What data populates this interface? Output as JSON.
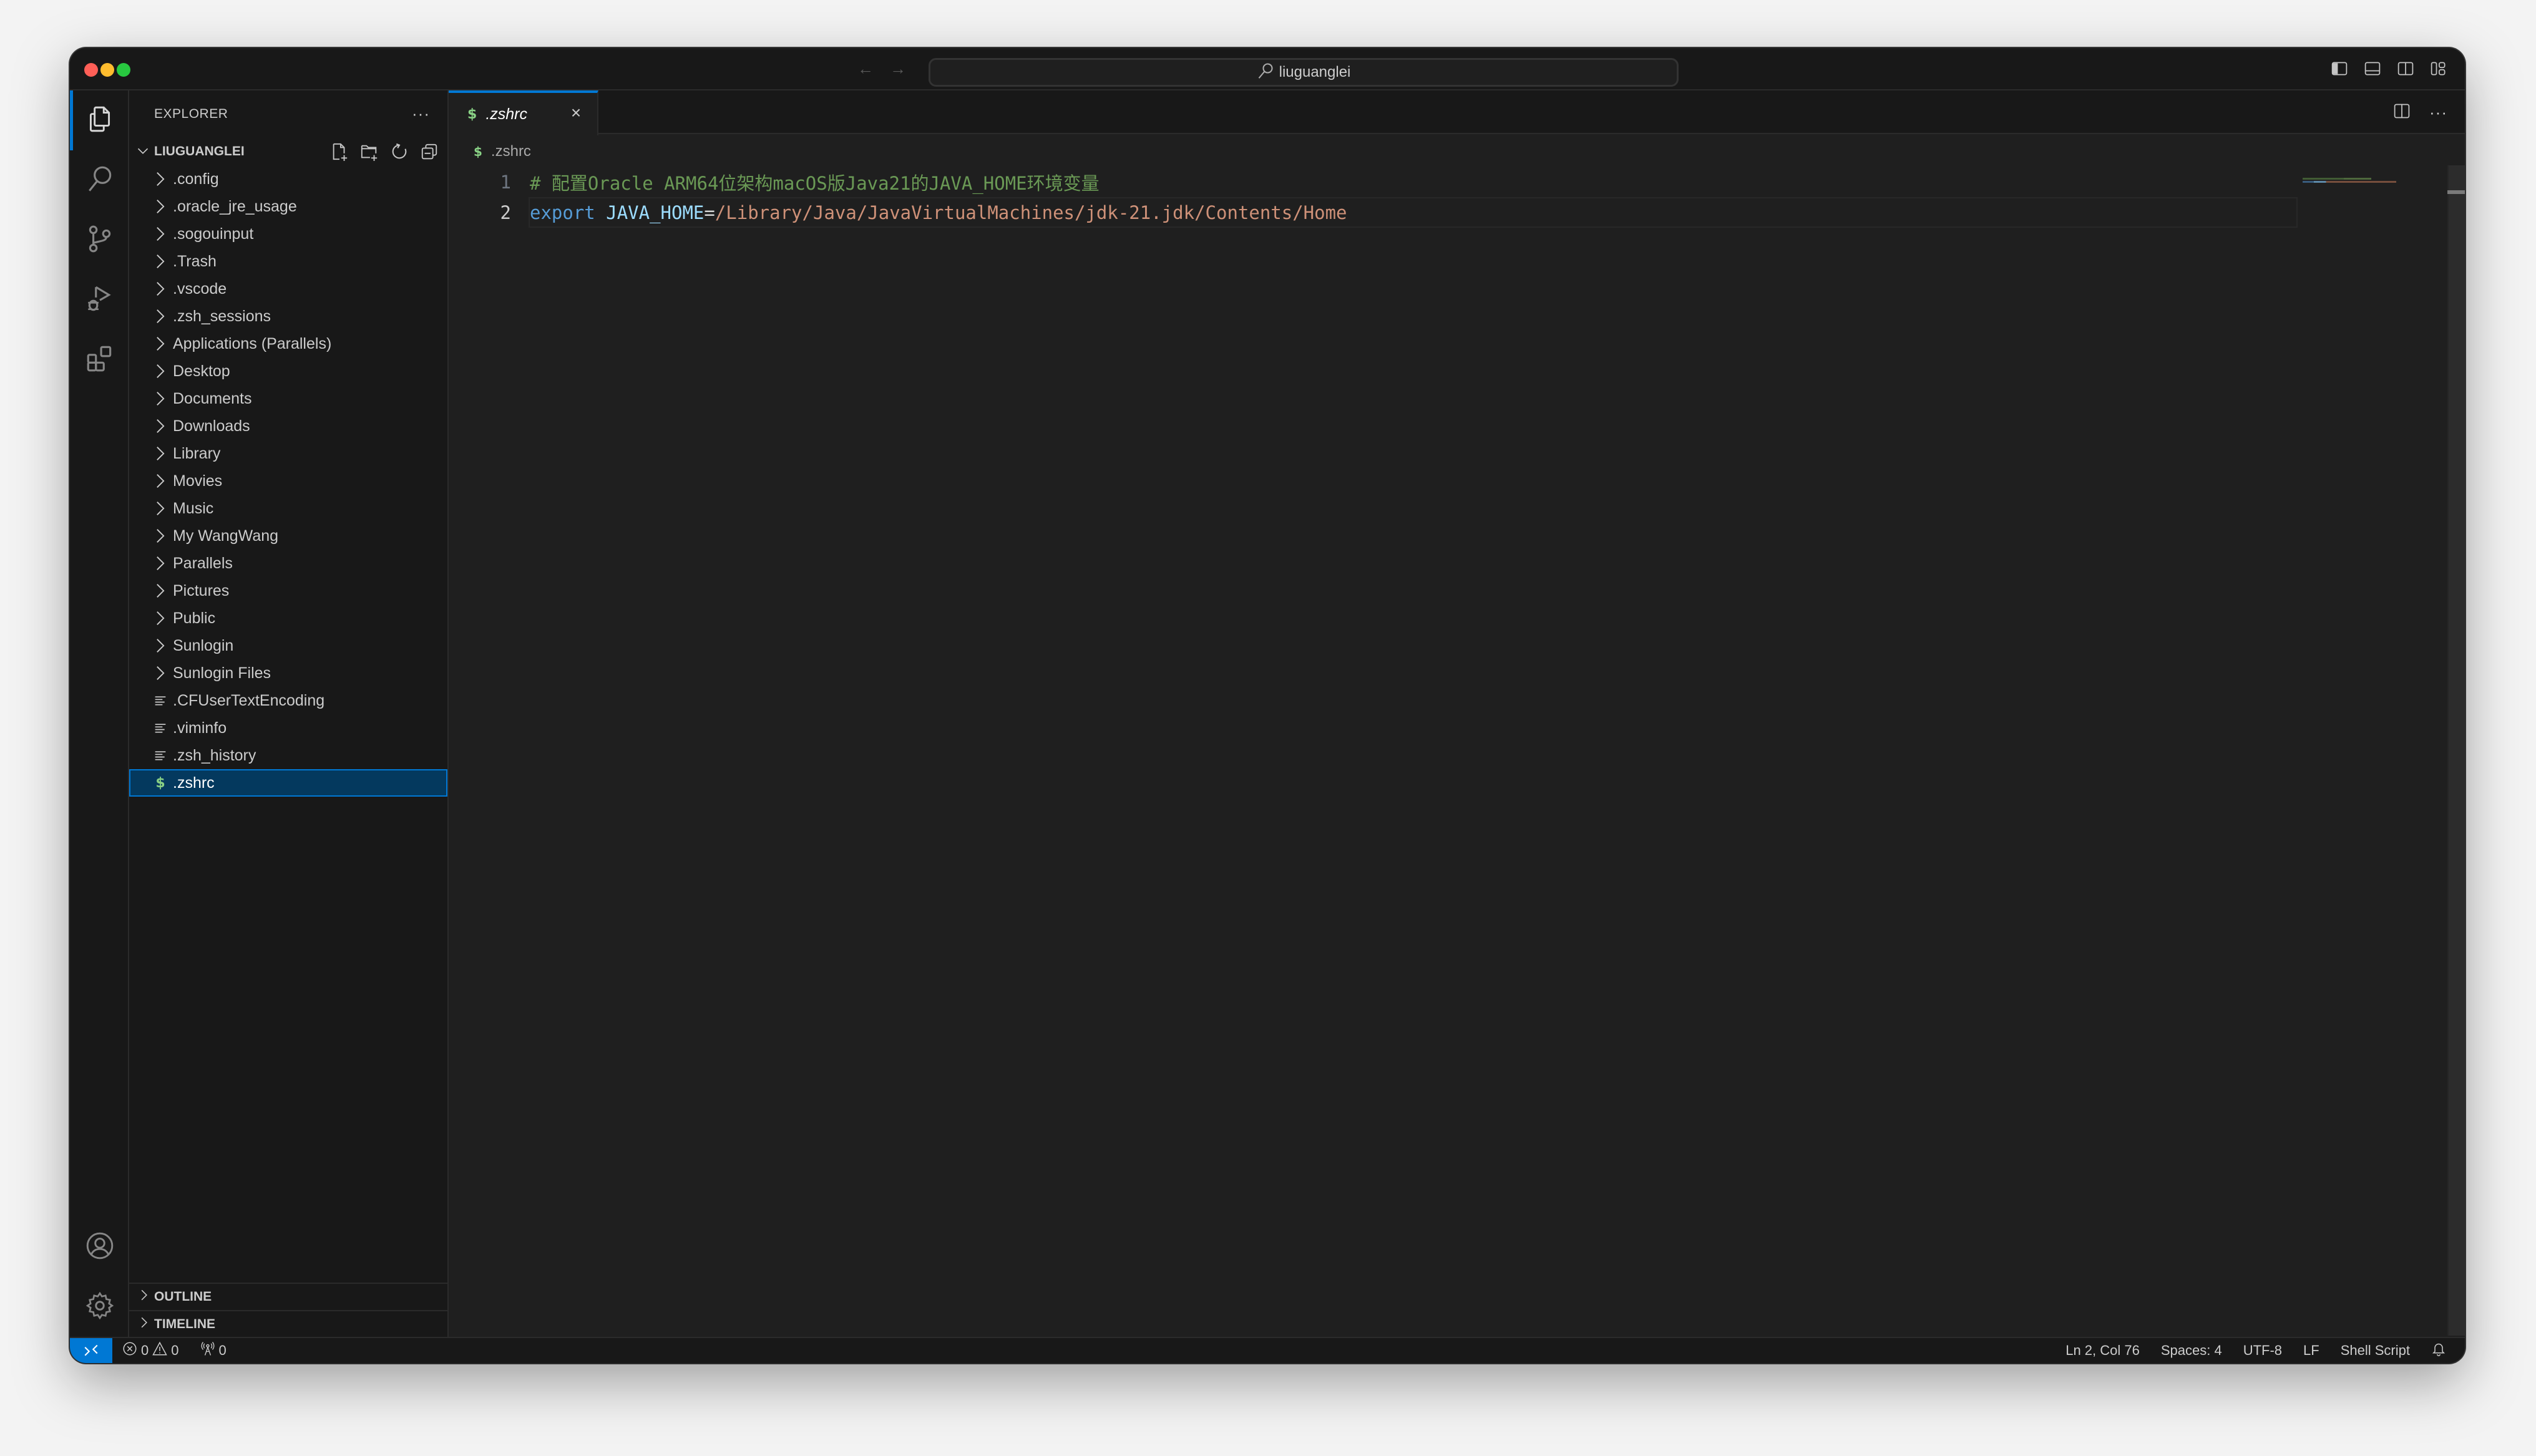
{
  "titlebar": {
    "search_text": "liuguanglei",
    "back_icon": "arrow-left-icon",
    "forward_icon": "arrow-right-icon",
    "layout_icons": [
      "toggle-primary-sidebar-icon",
      "toggle-panel-icon",
      "toggle-secondary-sidebar-icon",
      "customize-layout-icon"
    ]
  },
  "activitybar": {
    "items": [
      {
        "name": "explorer",
        "icon": "files-icon",
        "active": true
      },
      {
        "name": "search",
        "icon": "search-icon",
        "active": false
      },
      {
        "name": "source-control",
        "icon": "source-control-icon",
        "active": false
      },
      {
        "name": "run-debug",
        "icon": "run-debug-icon",
        "active": false
      },
      {
        "name": "extensions",
        "icon": "extensions-icon",
        "active": false
      }
    ],
    "bottom": [
      {
        "name": "accounts",
        "icon": "account-icon"
      },
      {
        "name": "manage",
        "icon": "gear-icon"
      }
    ]
  },
  "sidebar": {
    "title": "EXPLORER",
    "more": "···",
    "root": "LIUGUANGLEI",
    "items": [
      {
        "label": ".config",
        "type": "folder"
      },
      {
        "label": ".oracle_jre_usage",
        "type": "folder"
      },
      {
        "label": ".sogouinput",
        "type": "folder"
      },
      {
        "label": ".Trash",
        "type": "folder"
      },
      {
        "label": ".vscode",
        "type": "folder"
      },
      {
        "label": ".zsh_sessions",
        "type": "folder"
      },
      {
        "label": "Applications (Parallels)",
        "type": "folder"
      },
      {
        "label": "Desktop",
        "type": "folder"
      },
      {
        "label": "Documents",
        "type": "folder"
      },
      {
        "label": "Downloads",
        "type": "folder"
      },
      {
        "label": "Library",
        "type": "folder"
      },
      {
        "label": "Movies",
        "type": "folder"
      },
      {
        "label": "Music",
        "type": "folder"
      },
      {
        "label": "My WangWang",
        "type": "folder"
      },
      {
        "label": "Parallels",
        "type": "folder"
      },
      {
        "label": "Pictures",
        "type": "folder"
      },
      {
        "label": "Public",
        "type": "folder"
      },
      {
        "label": "Sunlogin",
        "type": "folder"
      },
      {
        "label": "Sunlogin Files",
        "type": "folder"
      },
      {
        "label": ".CFUserTextEncoding",
        "type": "file"
      },
      {
        "label": ".viminfo",
        "type": "file"
      },
      {
        "label": ".zsh_history",
        "type": "file"
      },
      {
        "label": ".zshrc",
        "type": "shell",
        "selected": true
      }
    ],
    "sections": {
      "outline": "OUTLINE",
      "timeline": "TIMELINE"
    }
  },
  "editor": {
    "tab": {
      "label": ".zshrc",
      "icon": "$"
    },
    "breadcrumb": {
      "icon": "$",
      "label": ".zshrc"
    },
    "more": "···",
    "lines": [
      {
        "number": "1",
        "tokens": [
          {
            "type": "comment",
            "text": "# 配置Oracle ARM64位架构macOS版Java21的JAVA_HOME环境变量"
          }
        ]
      },
      {
        "number": "2",
        "current": true,
        "tokens": [
          {
            "type": "keyword",
            "text": "export"
          },
          {
            "type": "op",
            "text": " "
          },
          {
            "type": "var",
            "text": "JAVA_HOME"
          },
          {
            "type": "op",
            "text": "="
          },
          {
            "type": "string",
            "text": "/Library/Java/JavaVirtualMachines/jdk-21.jdk/Contents/Home"
          }
        ]
      }
    ]
  },
  "statusbar": {
    "errors": "0",
    "warnings": "0",
    "ports": "0",
    "position": "Ln 2, Col 76",
    "indent": "Spaces: 4",
    "encoding": "UTF-8",
    "eol": "LF",
    "language": "Shell Script"
  },
  "colors": {
    "accent": "#0078d4",
    "selection_bg": "#04395e",
    "shell_icon": "#89d185",
    "comment": "#6a9955",
    "keyword": "#569cd6",
    "variable": "#9cdcfe",
    "string": "#ce9178"
  }
}
